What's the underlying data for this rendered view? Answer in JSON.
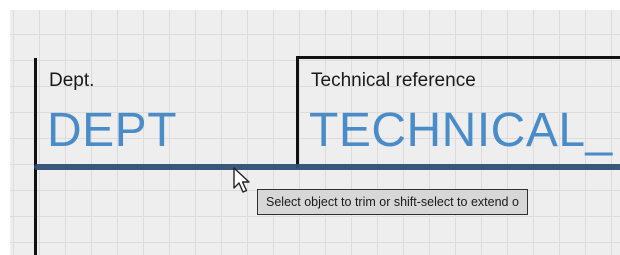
{
  "drawing": {
    "fields": [
      {
        "label": "Dept.",
        "value": "DEPT"
      },
      {
        "label": "Technical reference",
        "value": "TECHNICAL_"
      }
    ]
  },
  "tooltip": {
    "text": "Select object to trim or shift-select to extend o"
  },
  "colors": {
    "field_value": "#4a8cc7",
    "highlight": "#2f4f74",
    "tooltip_bg": "#d7d7d7"
  },
  "icons": [
    "arrow-cursor-icon"
  ]
}
